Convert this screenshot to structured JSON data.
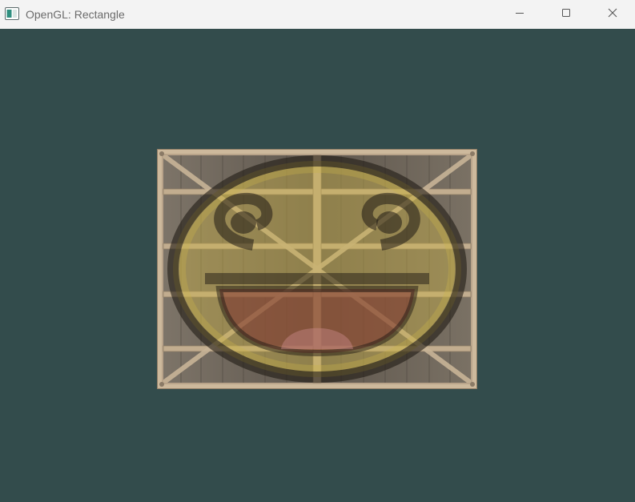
{
  "window": {
    "title": "OpenGL: Rectangle",
    "clear_color": "#334c4c",
    "titlebar_color": "#f3f3f3"
  },
  "titlebar": {
    "app_icon": "opengl-app-icon",
    "buttons": [
      {
        "name": "minimize",
        "icon": "minimize-icon"
      },
      {
        "name": "maximize",
        "icon": "maximize-icon"
      },
      {
        "name": "close",
        "icon": "close-icon"
      }
    ]
  },
  "scene": {
    "object": "textured-rectangle",
    "textures": [
      "wooden-container",
      "awesome-face"
    ],
    "colors": {
      "wood_light": "#b9a48a",
      "wood_dark": "#6e6355",
      "face_yellow": "#c9b24a",
      "face_outline": "#2a2218",
      "mouth": "#7a2e2e"
    }
  }
}
